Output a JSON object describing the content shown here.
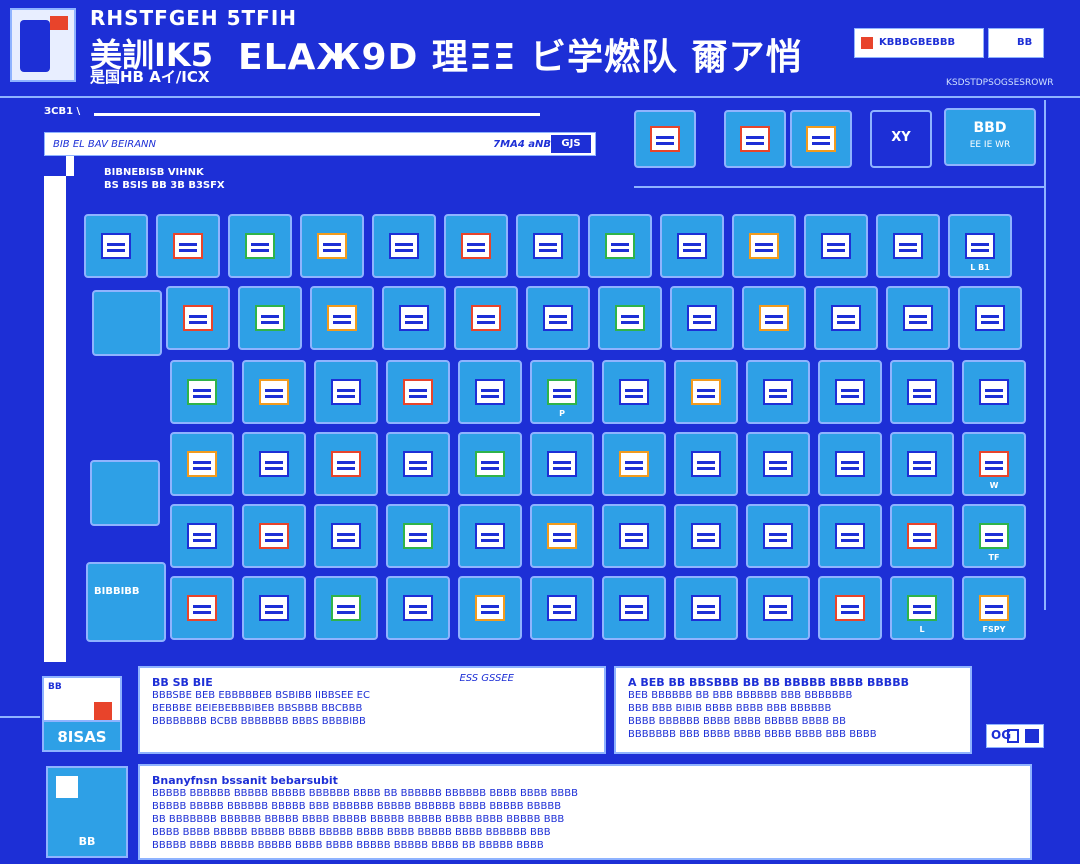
{
  "header": {
    "title_line1": "RHSTFGEH 5TFIH",
    "title_line2": "美訓IK5",
    "title_line3": "是国HB Aイ/ICX",
    "headline": "ELAЖ9D 理ΞΞ ビ学燃队 爾ア悄",
    "badge": "KBBBGBEBBB",
    "badge2": "BB",
    "link": "KSDSTDPSOGSESROWR"
  },
  "toolbar": {
    "breadcrumb": "ЗСВ1 \\",
    "search_placeholder": "BIB EL BAV BEIRANN",
    "search_option": "7MA4 aNB",
    "search_button": "GJS",
    "filter_label_1": "BIBNEBISB VIHNK",
    "filter_label_2": "BS BSIS BB 3B B3SFX"
  },
  "top_tiles": [
    {
      "label": "",
      "sub": "",
      "accent": "red"
    },
    {
      "label": "",
      "sub": "",
      "accent": "red"
    },
    {
      "label": "",
      "sub": "",
      "accent": "orange"
    },
    {
      "label": "XY",
      "sub": ""
    },
    {
      "label": "BBD",
      "sub": "EE IE WR"
    }
  ],
  "grid": {
    "rows": [
      [
        "",
        "",
        "",
        "",
        "",
        "",
        "",
        "",
        "",
        "",
        "",
        "",
        "L B1"
      ],
      [
        "",
        "",
        "",
        "",
        "",
        "",
        "",
        "",
        "",
        "",
        "",
        ""
      ],
      [
        "",
        "",
        "",
        "",
        "",
        "P",
        "",
        "",
        "",
        "",
        "",
        ""
      ],
      [
        "",
        "",
        "",
        "",
        "",
        "",
        "",
        "",
        "",
        "",
        "",
        "W"
      ],
      [
        "",
        "",
        "",
        "",
        "",
        "",
        "",
        "",
        "",
        "",
        "",
        "TF"
      ],
      [
        "",
        "",
        "",
        "",
        "",
        "",
        "",
        "",
        "",
        "",
        "L",
        "FSPY"
      ]
    ]
  },
  "side_tiles": [
    {
      "label": ""
    },
    {
      "label": ""
    },
    {
      "label": "BIBBIBB"
    }
  ],
  "info_left": {
    "title": "BB SB BIE",
    "meta": "ESS GSSEE",
    "lines": [
      "BBBSBE BEB EBBBBBEB BSBIBB IIBBSEE EC",
      "BEBBBE BEIEBEBBBIBEB BBSBBB BBCBBB",
      "BBBBBBBB BCBB BBBBBBB BBBS BBBBIBB"
    ]
  },
  "info_right": {
    "title": "A BEB BB BBSBBB BB BB BBBBB BBBB BBBBB",
    "lines": [
      "BEB BBBBBB BB BBB BBBBBB BBB BBBBBBB",
      "BBB BBB BIBIB BBBB BBBB BBB BBBBBB",
      "BBBB BBBBBB BBBB BBBB BBBBB BBBB BB",
      "BBBBBBB BBB BBBB BBBB BBBB BBBB BBB BBBB"
    ]
  },
  "info_bottom": {
    "title": "Bnanyfnsn bssanit bebarsubit",
    "lines": [
      "BBBBB BBBBBB BBBBB BBBBB BBBBBB BBBB BB BBBBBB BBBBBB BBBB BBBB BBBB",
      "BBBBB BBBBB BBBBBB BBBBB BBB BBBBBB BBBBB BBBBBB BBBB BBBBB BBBBB",
      "BB BBBBBBB BBBBBB BBBBB BBBB BBBBB BBBBB BBBBB BBBB BBBB BBBBB BBB",
      "BBBB BBBB BBBBB BBBBB BBBB BBBBB BBBB BBBB BBBBB BBBB BBBBBB BBB",
      "BBBBB BBBB BBBBB BBBBB BBBB BBBB BBBBB BBBBB BBBB BB BBBBB BBBB"
    ]
  },
  "bottom_card": {
    "title": "BB",
    "label": "8ISAS"
  },
  "card_thumb": {
    "label": "BB"
  },
  "page_indicator": {
    "label": "OG"
  },
  "colors": {
    "background": "#1d2fd6",
    "tile": "#2ea0e6",
    "outline": "#8fb3ff",
    "accent_red": "#e8442b",
    "accent_green": "#2fb34a",
    "accent_orange": "#f29b1d"
  }
}
